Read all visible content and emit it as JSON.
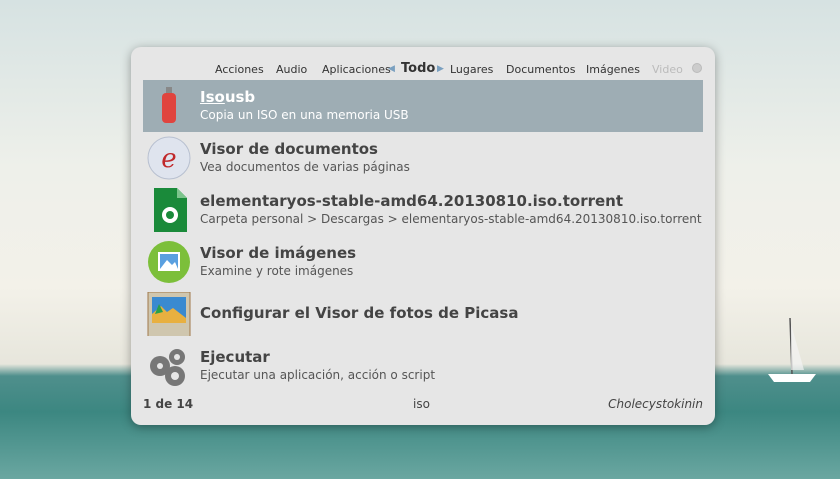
{
  "tabs": [
    "Acciones",
    "Audio",
    "Aplicaciones",
    "Todo",
    "Lugares",
    "Documentos",
    "Imágenes",
    "Video"
  ],
  "active_tab": "Todo",
  "results": [
    {
      "title_match": "Iso",
      "title_rest": "usb",
      "subtitle": "Copia un ISO en una memoria USB",
      "icon": "usb-drive-icon",
      "selected": true
    },
    {
      "title": "Visor de documentos",
      "subtitle": "Vea documentos de varias páginas",
      "icon": "document-viewer-icon"
    },
    {
      "title": "elementaryos-stable-amd64.20130810.iso.torrent",
      "subtitle": "Carpeta personal > Descargas > elementaryos-stable-amd64.20130810.iso.torrent",
      "icon": "torrent-file-icon"
    },
    {
      "title": "Visor de imágenes",
      "subtitle": "Examine y rote imágenes",
      "icon": "image-viewer-icon"
    },
    {
      "title": "Configurar el Visor de fotos de Picasa",
      "icon": "picture-icon"
    },
    {
      "title": "Ejecutar",
      "subtitle": "Ejecutar una aplicación, acción o script",
      "icon": "gears-icon"
    }
  ],
  "footer": {
    "count": "1 de 14",
    "query": "iso",
    "theme": "Cholecystokinin"
  },
  "colors": {
    "selection": "#9eadb4",
    "window": "#e6e6e6"
  }
}
